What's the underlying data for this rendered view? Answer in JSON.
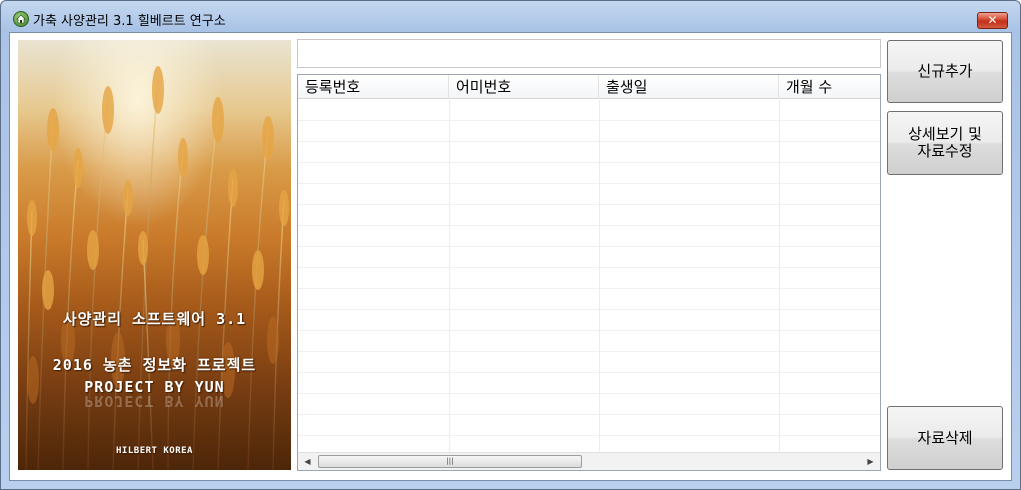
{
  "window": {
    "title": "가축 사양관리 3.1 힐베르트 연구소",
    "close_glyph": "✕",
    "icon": "house-icon"
  },
  "banner": {
    "line1": "사양관리 소프트웨어 3.1",
    "line2": "2016 농촌 정보화 프로젝트",
    "line3": "PROJECT BY YUN",
    "line4": "HILBERT KOREA"
  },
  "list": {
    "columns": [
      "등록번호",
      "어미번호",
      "출생일",
      "개월 수"
    ],
    "rows": []
  },
  "scrollbar": {
    "left_arrow": "◀",
    "right_arrow": "▶",
    "thumb_grip": "|||"
  },
  "buttons": {
    "new": "신규추가",
    "detail": "상세보기 및\n자료수정",
    "delete": "자료삭제"
  }
}
